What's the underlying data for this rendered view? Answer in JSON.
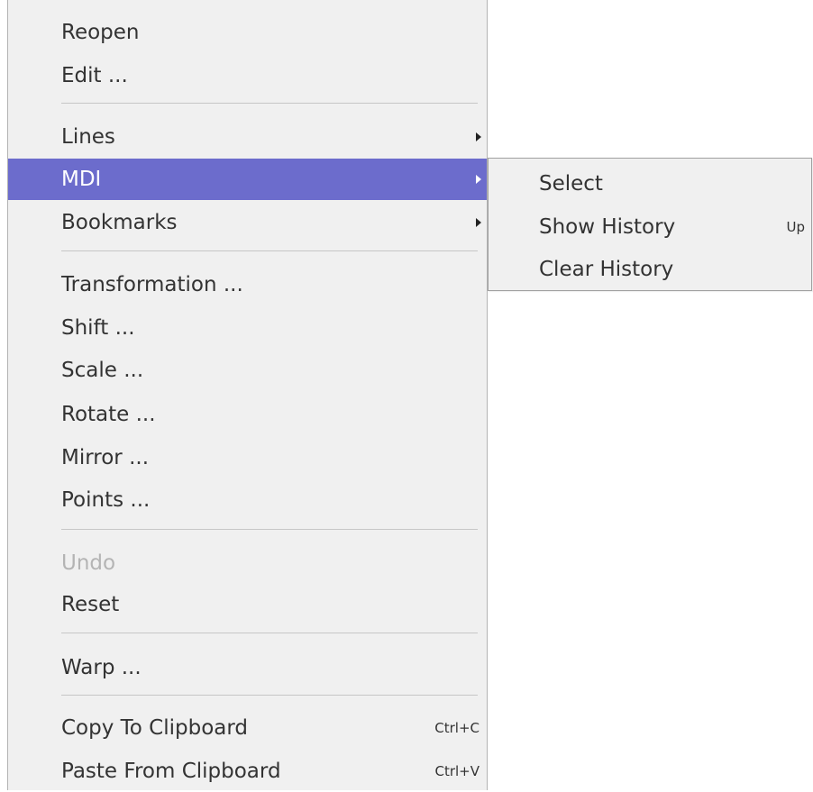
{
  "main_menu": {
    "items": [
      {
        "label": "Reopen"
      },
      {
        "label": "Edit ..."
      },
      {
        "label": "Lines"
      },
      {
        "label": "MDI"
      },
      {
        "label": "Bookmarks"
      },
      {
        "label": "Transformation ..."
      },
      {
        "label": "Shift ..."
      },
      {
        "label": "Scale ..."
      },
      {
        "label": "Rotate ..."
      },
      {
        "label": "Mirror ..."
      },
      {
        "label": "Points ..."
      },
      {
        "label": "Undo"
      },
      {
        "label": "Reset"
      },
      {
        "label": "Warp ..."
      },
      {
        "label": "Copy To Clipboard",
        "shortcut": "Ctrl+C"
      },
      {
        "label": "Paste From Clipboard",
        "shortcut": "Ctrl+V"
      }
    ]
  },
  "mdi_submenu": {
    "items": [
      {
        "label": "Select"
      },
      {
        "label": "Show History",
        "shortcut": "Up"
      },
      {
        "label": "Clear History"
      }
    ]
  },
  "colors": {
    "menu_background": "#f0f0f0",
    "highlight_background": "#6c6ccc",
    "highlight_text": "#ffffff",
    "text": "#333333",
    "disabled_text": "#b4b4b4",
    "separator": "#c6c6c6"
  },
  "icons": {
    "submenu_arrow": "triangle-right-icon"
  }
}
